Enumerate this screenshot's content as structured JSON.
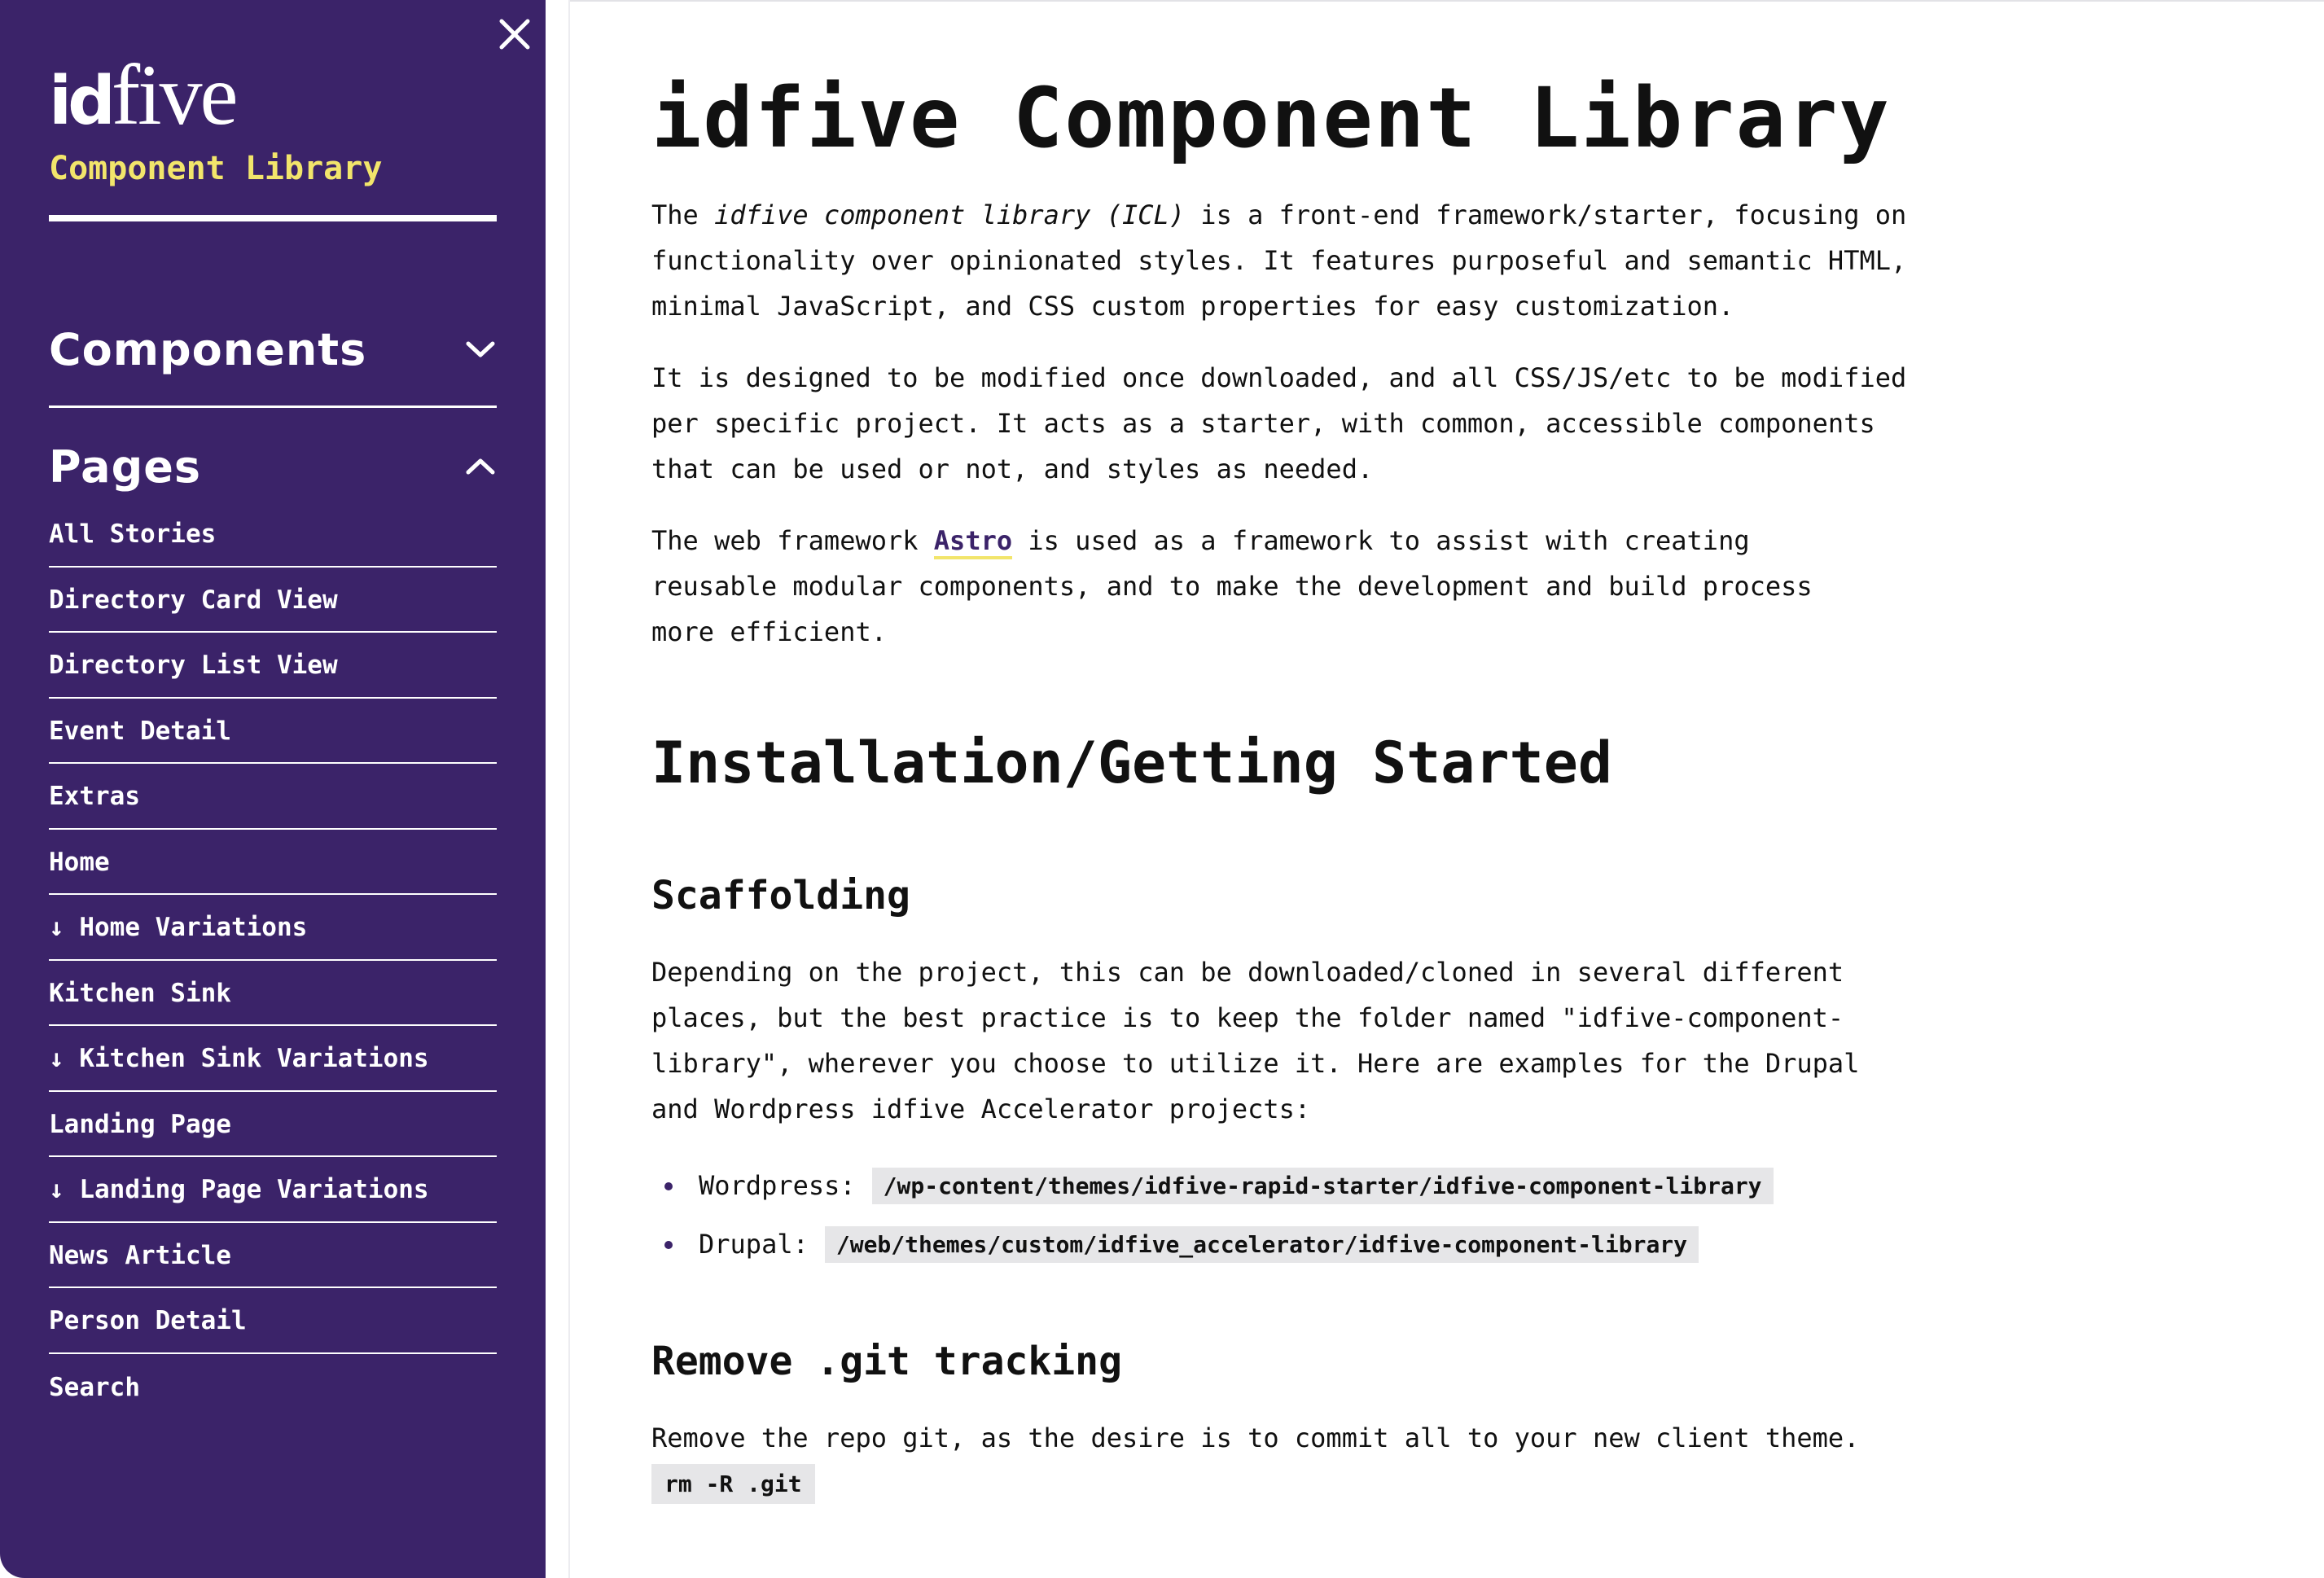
{
  "sidebar": {
    "logo_id": "id",
    "logo_five": "five",
    "subtitle": "Component Library",
    "components_label": "Components",
    "pages_label": "Pages",
    "items": [
      {
        "label": "All Stories"
      },
      {
        "label": "Directory Card View"
      },
      {
        "label": "Directory List View"
      },
      {
        "label": "Event Detail"
      },
      {
        "label": "Extras"
      },
      {
        "label": "Home"
      },
      {
        "label": "↓ Home Variations"
      },
      {
        "label": "Kitchen Sink"
      },
      {
        "label": "↓ Kitchen Sink Variations"
      },
      {
        "label": "Landing Page"
      },
      {
        "label": "↓ Landing Page Variations"
      },
      {
        "label": "News Article"
      },
      {
        "label": "Person Detail"
      },
      {
        "label": "Search"
      }
    ]
  },
  "main": {
    "title": "idfive Component Library",
    "intro": {
      "p1_before": "The ",
      "p1_em": "idfive component library (ICL)",
      "p1_line1_rest": " is a front-end framework/starter, focusing on",
      "p1_line2": "functionality over opinionated styles. It features purposeful and semantic HTML,",
      "p1_line3": "minimal JavaScript, and CSS custom properties for easy customization.",
      "p2_line1": "It is designed to be modified once downloaded, and all CSS/JS/etc to be modified",
      "p2_line2": "per specific project. It acts as a starter, with common, accessible components",
      "p2_line3": "that can be used or not, and styles as needed.",
      "p3_before": "The web framework ",
      "p3_link": "Astro",
      "p3_line1_rest": " is used as a framework to assist with creating",
      "p3_line2": "reusable modular components, and to make the development and build process",
      "p3_line3": "more efficient."
    },
    "install_heading": "Installation/Getting Started",
    "scaffolding": {
      "heading": "Scaffolding",
      "line1": "Depending on the project, this can be downloaded/cloned in several different",
      "line2": "places, but the best practice is to keep the folder named \"idfive-component-",
      "line3": "library\", wherever you choose to utilize it. Here are examples for the Drupal",
      "line4": "and Wordpress idfive Accelerator projects:",
      "bullets": [
        {
          "label": "Wordpress:",
          "code": "/wp-content/themes/idfive-rapid-starter/idfive-component-library"
        },
        {
          "label": "Drupal:",
          "code": "/web/themes/custom/idfive_accelerator/idfive-component-library"
        }
      ]
    },
    "git": {
      "heading": "Remove .git tracking",
      "text": "Remove the repo git, as the desire is to commit all to your new client theme.",
      "code": "rm -R .git"
    }
  },
  "colors": {
    "sidebar_bg": "#3b2369",
    "accent_yellow": "#f2e56b",
    "code_bg": "#e6e6e8"
  },
  "icons": {
    "close": "close-icon",
    "components_toggle": "chevron-down-icon",
    "pages_toggle": "chevron-up-icon"
  }
}
